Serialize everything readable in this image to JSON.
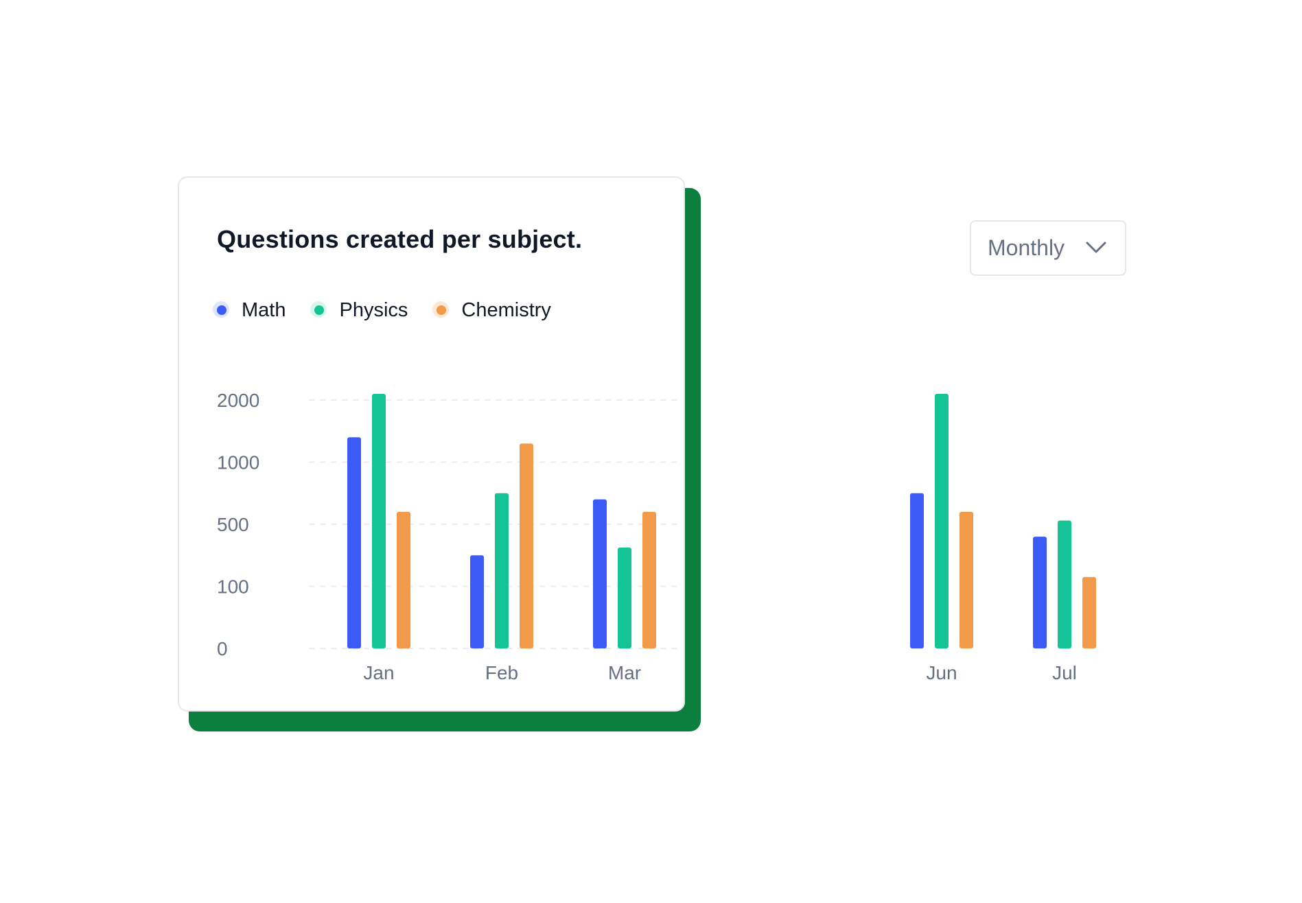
{
  "chart_title": "Questions created per subject.",
  "dropdown": {
    "selected": "Monthly",
    "icon": "chevron-down-icon"
  },
  "legend": [
    {
      "label": "Math",
      "color": "#3b5bf7"
    },
    {
      "label": "Physics",
      "color": "#14c495"
    },
    {
      "label": "Chemistry",
      "color": "#f29a4a"
    }
  ],
  "colors": {
    "accent_shadow": "#0c7f3f",
    "grid": "#e9edf2",
    "tick_text": "#667085"
  },
  "chart_data": {
    "type": "bar",
    "title": "Questions created per subject.",
    "xlabel": "",
    "ylabel": "",
    "y_ticks": [
      0,
      100,
      500,
      1000,
      2000
    ],
    "y_scale": "non-uniform (ticks evenly spaced)",
    "grid": "horizontal dashed",
    "legend_position": "top-left",
    "categories": [
      "Jan",
      "Feb",
      "Mar",
      "Jun",
      "Jul"
    ],
    "series": [
      {
        "name": "Math",
        "values": [
          1400,
          300,
          700,
          750,
          420
        ]
      },
      {
        "name": "Physics",
        "values": [
          2100,
          750,
          350,
          2100,
          530
        ]
      },
      {
        "name": "Chemistry",
        "values": [
          600,
          1300,
          600,
          600,
          160
        ]
      }
    ]
  }
}
